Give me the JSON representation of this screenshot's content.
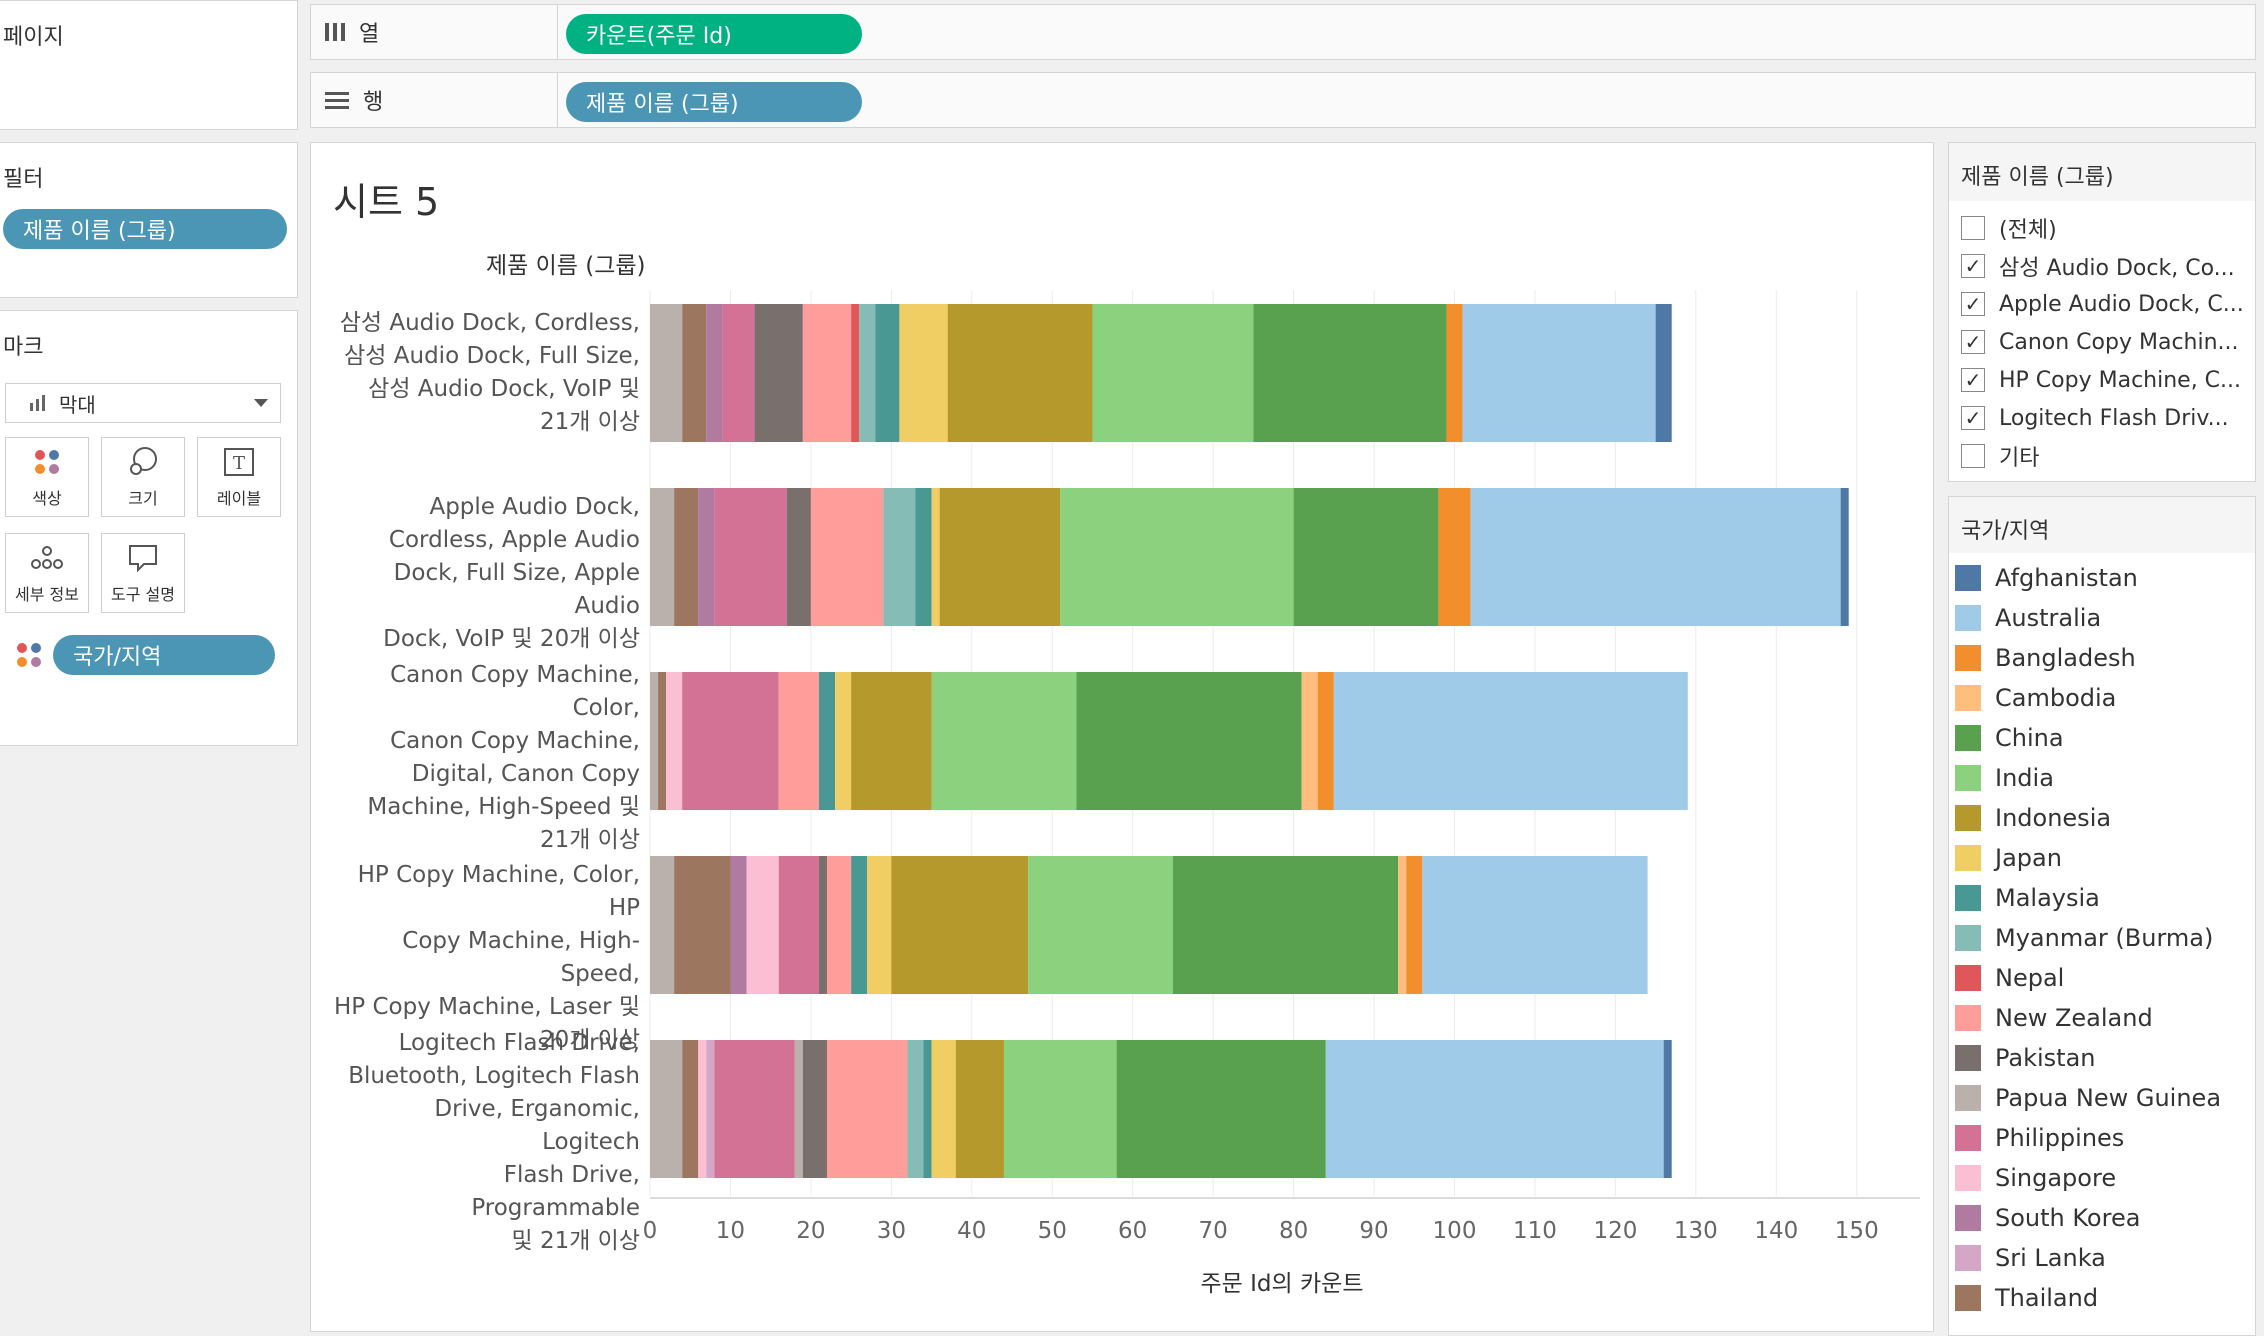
{
  "pages_panel": {
    "title": "페이지"
  },
  "filters_panel": {
    "title": "필터",
    "pill": "제품 이름 (그룹)"
  },
  "marks_panel": {
    "title": "마크",
    "mark_type": "막대",
    "buttons": {
      "color": "색상",
      "size": "크기",
      "label": "레이블",
      "detail": "세부 정보",
      "tooltip": "도구 설명"
    },
    "color_pill": "국가/지역"
  },
  "shelves": {
    "columns": {
      "label": "열",
      "pill": "카운트(주문 Id)"
    },
    "rows": {
      "label": "행",
      "pill": "제품 이름 (그룹)"
    }
  },
  "sheet": {
    "title": "시트 5",
    "row_header": "제품 이름 (그룹)"
  },
  "filter_card": {
    "title": "제품 이름 (그룹)",
    "items": [
      {
        "label": "(전체)",
        "checked": false
      },
      {
        "label": "삼성 Audio Dock, Co...",
        "checked": true
      },
      {
        "label": "Apple Audio Dock, C...",
        "checked": true
      },
      {
        "label": "Canon Copy Machin...",
        "checked": true
      },
      {
        "label": "HP Copy Machine, C...",
        "checked": true
      },
      {
        "label": "Logitech Flash Driv...",
        "checked": true
      },
      {
        "label": "기타",
        "checked": false
      }
    ]
  },
  "legend": {
    "title": "국가/지역",
    "items": [
      {
        "name": "Afghanistan",
        "color": "#4e79a7"
      },
      {
        "name": "Australia",
        "color": "#a0cbe8"
      },
      {
        "name": "Bangladesh",
        "color": "#f28e2b"
      },
      {
        "name": "Cambodia",
        "color": "#ffbe7d"
      },
      {
        "name": "China",
        "color": "#59a14f"
      },
      {
        "name": "India",
        "color": "#8cd17d"
      },
      {
        "name": "Indonesia",
        "color": "#b6992d"
      },
      {
        "name": "Japan",
        "color": "#f1ce63"
      },
      {
        "name": "Malaysia",
        "color": "#499894"
      },
      {
        "name": "Myanmar (Burma)",
        "color": "#86bcb6"
      },
      {
        "name": "Nepal",
        "color": "#e15759"
      },
      {
        "name": "New Zealand",
        "color": "#ff9d9a"
      },
      {
        "name": "Pakistan",
        "color": "#79706e"
      },
      {
        "name": "Papua New Guinea",
        "color": "#bab0ac"
      },
      {
        "name": "Philippines",
        "color": "#d37295"
      },
      {
        "name": "Singapore",
        "color": "#fabfd2"
      },
      {
        "name": "South Korea",
        "color": "#b07aa1"
      },
      {
        "name": "Sri Lanka",
        "color": "#d4a6c8"
      },
      {
        "name": "Thailand",
        "color": "#9d7660"
      }
    ]
  },
  "chart_data": {
    "type": "bar",
    "orientation": "horizontal",
    "stacked": true,
    "xlabel": "주문 Id의 카운트",
    "ylabel": "제품 이름 (그룹)",
    "xlim": [
      0,
      157
    ],
    "xticks": [
      0,
      10,
      20,
      30,
      40,
      50,
      60,
      70,
      80,
      90,
      100,
      110,
      120,
      130,
      140,
      150
    ],
    "grid": true,
    "categories": [
      [
        "삼성 Audio Dock, Cordless,",
        "삼성 Audio Dock, Full Size,",
        "삼성 Audio Dock, VoIP 및",
        "21개 이상"
      ],
      [
        "Apple Audio Dock,",
        "Cordless, Apple Audio",
        "Dock, Full Size, Apple Audio",
        "Dock, VoIP 및 20개 이상"
      ],
      [
        "Canon Copy Machine, Color,",
        "Canon Copy Machine,",
        "Digital, Canon Copy",
        "Machine, High-Speed 및",
        "21개 이상"
      ],
      [
        "HP Copy Machine, Color, HP",
        "Copy Machine, High-Speed,",
        "HP Copy Machine, Laser 및",
        "20개 이상"
      ],
      [
        "Logitech Flash Drive,",
        "Bluetooth, Logitech Flash",
        "Drive, Erganomic, Logitech",
        "Flash Drive, Programmable",
        "및 21개 이상"
      ]
    ],
    "series": [
      {
        "name": "Bangladesh",
        "values": [
          2,
          4,
          0,
          1,
          0
        ]
      },
      {
        "name": "Pakistan",
        "values": [
          6,
          2,
          0,
          1,
          3
        ]
      },
      {
        "name": "Philippines",
        "values": [
          5,
          9,
          12,
          5,
          10
        ]
      },
      {
        "name": "New Zealand",
        "values": [
          6,
          9,
          5,
          3,
          10
        ]
      }
    ],
    "segments": [
      [
        [
          "Papua New Guinea",
          4
        ],
        [
          "Thailand",
          3
        ],
        [
          "South Korea",
          2
        ],
        [
          "Philippines",
          4
        ],
        [
          "Pakistan",
          6
        ],
        [
          "New Zealand",
          6
        ],
        [
          "Nepal",
          1
        ],
        [
          "Myanmar (Burma)",
          2
        ],
        [
          "Malaysia",
          3
        ],
        [
          "Japan",
          6
        ],
        [
          "Indonesia",
          18
        ],
        [
          "India",
          20
        ],
        [
          "China",
          24
        ],
        [
          "Bangladesh",
          2
        ],
        [
          "Australia",
          24
        ],
        [
          "Afghanistan",
          2
        ]
      ],
      [
        [
          "Papua New Guinea",
          3
        ],
        [
          "Thailand",
          3
        ],
        [
          "South Korea",
          2
        ],
        [
          "Philippines",
          9
        ],
        [
          "Pakistan",
          3
        ],
        [
          "New Zealand",
          9
        ],
        [
          "Myanmar (Burma)",
          4
        ],
        [
          "Malaysia",
          2
        ],
        [
          "Japan",
          1
        ],
        [
          "Indonesia",
          15
        ],
        [
          "India",
          29
        ],
        [
          "China",
          18
        ],
        [
          "Bangladesh",
          4
        ],
        [
          "Australia",
          46
        ],
        [
          "Afghanistan",
          1
        ]
      ],
      [
        [
          "Papua New Guinea",
          1
        ],
        [
          "Thailand",
          1
        ],
        [
          "Singapore",
          2
        ],
        [
          "Philippines",
          12
        ],
        [
          "New Zealand",
          5
        ],
        [
          "Malaysia",
          2
        ],
        [
          "Japan",
          2
        ],
        [
          "Indonesia",
          10
        ],
        [
          "India",
          18
        ],
        [
          "China",
          28
        ],
        [
          "Cambodia",
          2
        ],
        [
          "Bangladesh",
          2
        ],
        [
          "Australia",
          44
        ]
      ],
      [
        [
          "Papua New Guinea",
          3
        ],
        [
          "Thailand",
          7
        ],
        [
          "South Korea",
          2
        ],
        [
          "Singapore",
          4
        ],
        [
          "Philippines",
          5
        ],
        [
          "Pakistan",
          1
        ],
        [
          "New Zealand",
          3
        ],
        [
          "Malaysia",
          2
        ],
        [
          "Japan",
          3
        ],
        [
          "Indonesia",
          17
        ],
        [
          "India",
          18
        ],
        [
          "China",
          28
        ],
        [
          "Cambodia",
          1
        ],
        [
          "Bangladesh",
          2
        ],
        [
          "Australia",
          28
        ]
      ],
      [
        [
          "Papua New Guinea",
          4
        ],
        [
          "Thailand",
          2
        ],
        [
          "Singapore",
          1
        ],
        [
          "Sri Lanka",
          1
        ],
        [
          "Philippines",
          10
        ],
        [
          "Papua New Guinea",
          1
        ],
        [
          "Pakistan",
          3
        ],
        [
          "New Zealand",
          10
        ],
        [
          "Myanmar (Burma)",
          2
        ],
        [
          "Malaysia",
          1
        ],
        [
          "Japan",
          3
        ],
        [
          "Indonesia",
          6
        ],
        [
          "India",
          14
        ],
        [
          "China",
          26
        ],
        [
          "Australia",
          42
        ],
        [
          "Afghanistan",
          1
        ]
      ]
    ]
  }
}
